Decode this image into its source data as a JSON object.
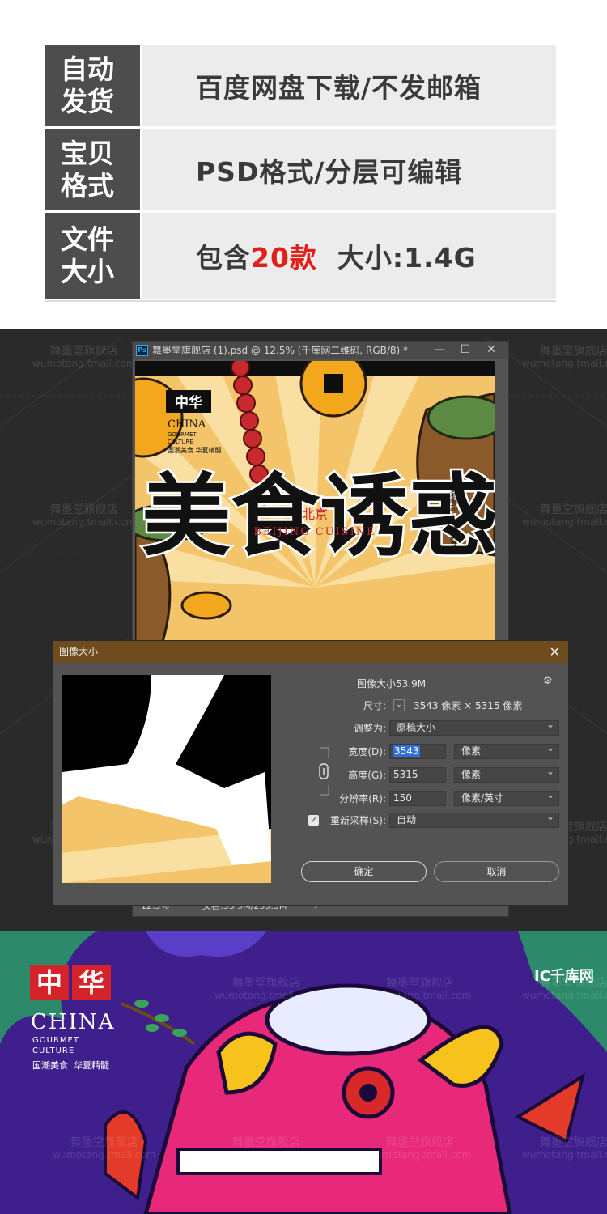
{
  "info_table": {
    "rows": [
      {
        "key_line1": "自动",
        "key_line2": "发货",
        "value": "百度网盘下载/不发邮箱"
      },
      {
        "key_line1": "宝贝",
        "key_line2": "格式",
        "value": "PSD格式/分层可编辑"
      },
      {
        "key_line1": "文件",
        "key_line2": "大小",
        "value_before": "包含",
        "value_highlight": "20款",
        "value_after": "  大小:1.4G"
      }
    ]
  },
  "watermark": {
    "name": "舞墨堂旗舰店",
    "url": "wumotang.tmall.com"
  },
  "photoshop": {
    "app_badge": "Ps",
    "document_title": "舞墨堂旗舰店 (1).psd @ 12.5% (千库网二维码, RGB/8) *",
    "minimize": "—",
    "maximize": "☐",
    "close": "✕",
    "zoom": "12.5%",
    "doc_info": "文档:53.9M/259.5M",
    "status_arrow": "›",
    "artwork": {
      "badge": "中华",
      "china": "CHINA",
      "gourmet": "GOURMET",
      "culture": "CULTURE",
      "tagline": "国潮美食  华夏精髓",
      "big_chars": "美食诱惑",
      "city": "北京",
      "subtitle": "BEIJING CUISINE",
      "side_text": "国潮崛起 · 玩酷美食"
    }
  },
  "image_size_dialog": {
    "title": "图像大小",
    "close": "✕",
    "image_size_label": "图像大小:",
    "image_size_value": "53.9M",
    "dimensions_label": "尺寸:",
    "dimensions_value": "3543 像素  ×  5315 像素",
    "fit_label": "调整为:",
    "fit_value": "原稿大小",
    "width_label": "宽度(D):",
    "width_value": "3543",
    "width_unit": "像素",
    "height_label": "高度(G):",
    "height_value": "5315",
    "height_unit": "像素",
    "resolution_label": "分辨率(R):",
    "resolution_value": "150",
    "resolution_unit": "像素/英寸",
    "resample_label": "重新采样(S):",
    "resample_value": "自动",
    "ok": "确定",
    "cancel": "取消"
  },
  "poster_preview": {
    "badge_left": "中",
    "badge_right": "华",
    "china": "CHINA",
    "gourmet": "GOURMET",
    "culture": "CULTURE",
    "tagline": "国潮美食  华夏精髓",
    "brand_logo": "IC千库网"
  },
  "colors": {
    "key_bg": "#4d4d4d",
    "value_bg": "#ececec",
    "highlight_red": "#e0201a",
    "ps_bg": "#2a2a2a",
    "dialog_title_bg": "#6e4c1e",
    "poster_purple": "#3f1f8c"
  }
}
